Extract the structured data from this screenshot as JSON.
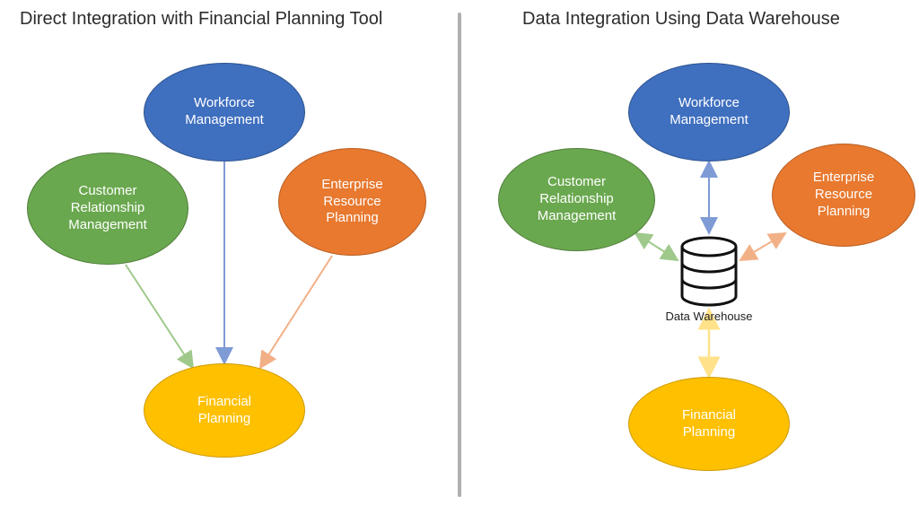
{
  "left": {
    "title": "Direct Integration with Financial Planning Tool",
    "nodes": {
      "workforce": "Workforce\nManagement",
      "crm": "Customer\nRelationship\nManagement",
      "erp": "Enterprise\nResource\nPlanning",
      "fp": "Financial\nPlanning"
    }
  },
  "right": {
    "title": "Data Integration Using Data Warehouse",
    "nodes": {
      "workforce": "Workforce\nManagement",
      "crm": "Customer\nRelationship\nManagement",
      "erp": "Enterprise\nResource\nPlanning",
      "fp": "Financial\nPlanning",
      "warehouse_label": "Data Warehouse"
    }
  },
  "colors": {
    "blue": "#3f6fbf",
    "green": "#6aa84f",
    "orange": "#e8792f",
    "yellow": "#ffc000",
    "blue_arrow": "#7f9bd6",
    "green_arrow": "#9fc98b",
    "orange_arrow": "#f2b087",
    "yellow_arrow": "#ffe28a"
  },
  "diagram_data": {
    "left": {
      "title": "Direct Integration with Financial Planning Tool",
      "nodes": [
        "Workforce Management",
        "Customer Relationship Management",
        "Enterprise Resource Planning",
        "Financial Planning"
      ],
      "edges": [
        {
          "from": "Workforce Management",
          "to": "Financial Planning",
          "bidirectional": false
        },
        {
          "from": "Customer Relationship Management",
          "to": "Financial Planning",
          "bidirectional": false
        },
        {
          "from": "Enterprise Resource Planning",
          "to": "Financial Planning",
          "bidirectional": false
        }
      ]
    },
    "right": {
      "title": "Data Integration Using Data Warehouse",
      "nodes": [
        "Workforce Management",
        "Customer Relationship Management",
        "Enterprise Resource Planning",
        "Data Warehouse",
        "Financial Planning"
      ],
      "edges": [
        {
          "from": "Workforce Management",
          "to": "Data Warehouse",
          "bidirectional": true
        },
        {
          "from": "Customer Relationship Management",
          "to": "Data Warehouse",
          "bidirectional": true
        },
        {
          "from": "Enterprise Resource Planning",
          "to": "Data Warehouse",
          "bidirectional": true
        },
        {
          "from": "Financial Planning",
          "to": "Data Warehouse",
          "bidirectional": true
        }
      ]
    }
  }
}
